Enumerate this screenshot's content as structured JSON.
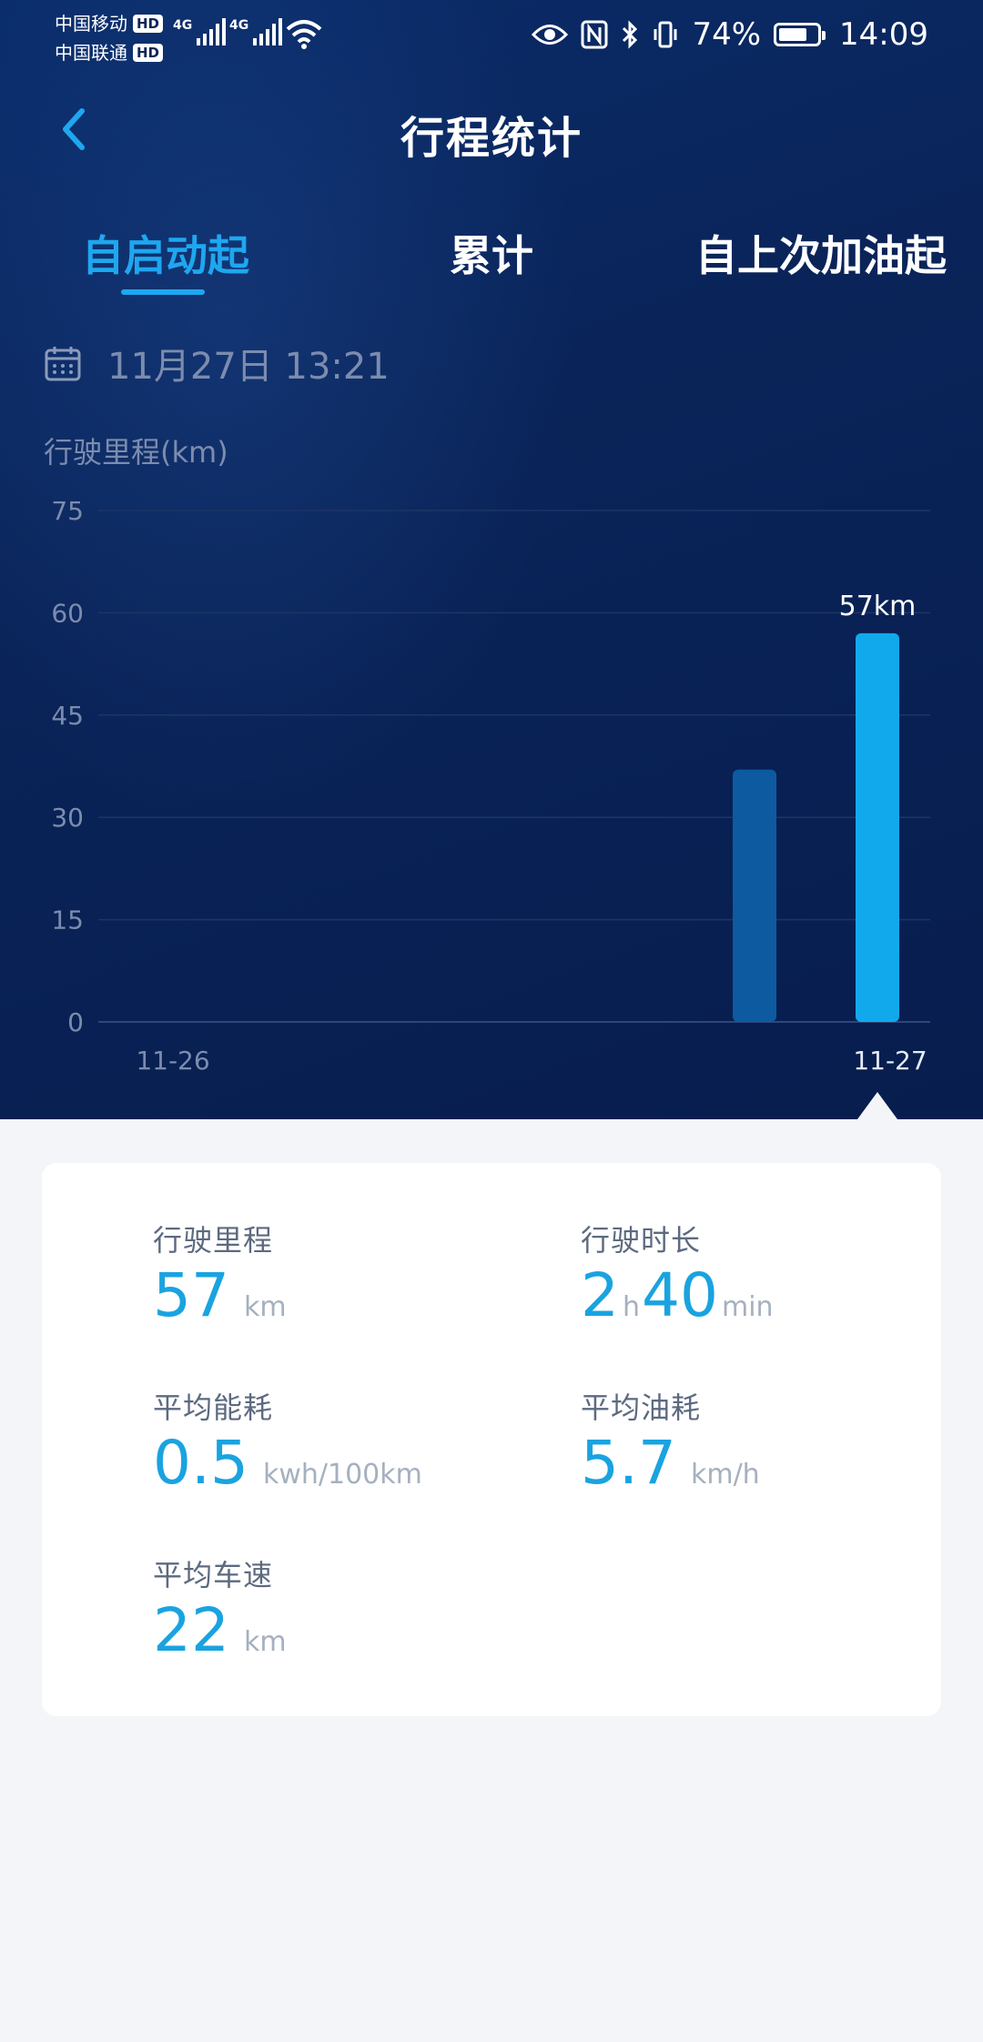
{
  "status_bar": {
    "carrier1": "中国移动",
    "carrier2": "中国联通",
    "hd": "HD",
    "net1": "4G",
    "net2": "4G",
    "battery": "74%",
    "battery_level": 0.74,
    "time": "14:09"
  },
  "header": {
    "title": "行程统计"
  },
  "tabs": [
    {
      "label": "自启动起",
      "active": true
    },
    {
      "label": "累计",
      "active": false
    },
    {
      "label": "自上次加油起",
      "active": false
    }
  ],
  "date": "11月27日 13:21",
  "chart_data": {
    "type": "bar",
    "ylabel": "行驶里程(km)",
    "ylim": [
      0,
      75
    ],
    "y_ticks": [
      "75",
      "60",
      "45",
      "30",
      "15",
      "0"
    ],
    "x_tick_labels": [
      "11-26",
      "11-27"
    ],
    "bars": [
      {
        "value": 37,
        "highlight": false,
        "label": ""
      },
      {
        "value": 57,
        "highlight": true,
        "label": "57km"
      }
    ],
    "grid": true,
    "colors": {
      "normal": "#0d5aa0",
      "highlight": "#12a9ec"
    }
  },
  "stats": {
    "distance": {
      "label": "行驶里程",
      "value": "57",
      "unit": "km"
    },
    "duration": {
      "label": "行驶时长",
      "hours": "2",
      "h_unit": "h",
      "minutes": "40",
      "m_unit": "min"
    },
    "avg_energy": {
      "label": "平均能耗",
      "value": "0.5",
      "unit": "kwh/100km"
    },
    "avg_fuel": {
      "label": "平均油耗",
      "value": "5.7",
      "unit": "km/h"
    },
    "avg_speed": {
      "label": "平均车速",
      "value": "22",
      "unit": "km"
    }
  },
  "colors": {
    "accent": "#1ea7ef",
    "value": "#1aa3e0",
    "hero_bg": "#0a2459"
  }
}
